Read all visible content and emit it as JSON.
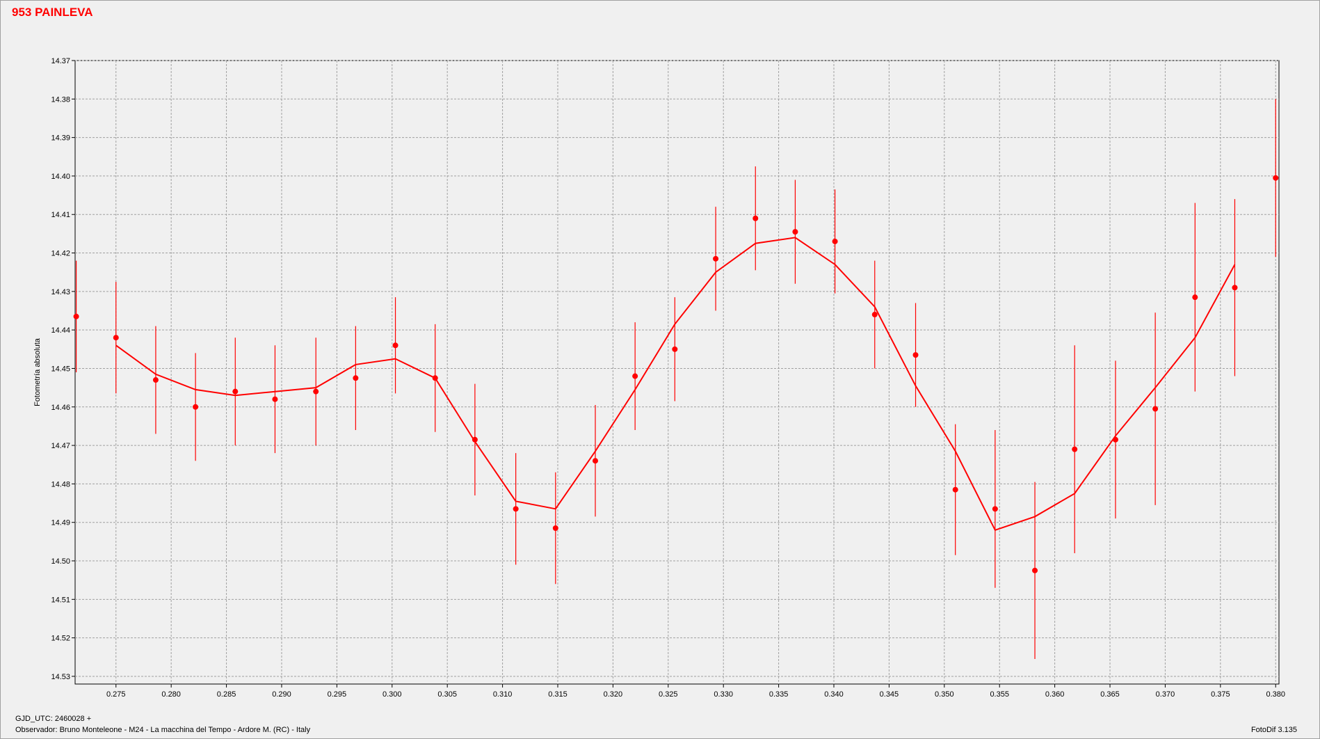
{
  "title": "953 PAINLEVA",
  "footer": {
    "gjd": "GJD_UTC: 2460028 +",
    "observer": "Observador: Bruno Monteleone - M24 - La macchina del Tempo - Ardore M. (RC) - Italy",
    "software": "FotoDif 3.135"
  },
  "colors": {
    "series": "#ff0000",
    "grid": "#a0a0a0",
    "background": "#f0f0f0"
  },
  "chart_data": {
    "type": "scatter",
    "title": "953 PAINLEVA",
    "xlabel": "",
    "ylabel": "Fotometría absoluta",
    "xlim": [
      0.2713,
      0.3803
    ],
    "ylim": [
      14.37,
      14.532
    ],
    "y_inverted": true,
    "grid": true,
    "x_ticks": [
      "0.275",
      "0.280",
      "0.285",
      "0.290",
      "0.295",
      "0.300",
      "0.305",
      "0.310",
      "0.315",
      "0.320",
      "0.325",
      "0.330",
      "0.335",
      "0.340",
      "0.345",
      "0.350",
      "0.355",
      "0.360",
      "0.365",
      "0.370",
      "0.375",
      "0.380"
    ],
    "y_ticks": [
      "14.37",
      "14.38",
      "14.39",
      "14.40",
      "14.41",
      "14.42",
      "14.43",
      "14.44",
      "14.45",
      "14.46",
      "14.47",
      "14.48",
      "14.49",
      "14.50",
      "14.51",
      "14.52",
      "14.53"
    ],
    "series": [
      {
        "kind": "points_with_errorbars",
        "x": [
          0.2714,
          0.275,
          0.2786,
          0.2822,
          0.2858,
          0.2894,
          0.2931,
          0.2967,
          0.3003,
          0.3039,
          0.3075,
          0.3112,
          0.3148,
          0.3184,
          0.322,
          0.3256,
          0.3293,
          0.3329,
          0.3365,
          0.3401,
          0.3437,
          0.3474,
          0.351,
          0.3546,
          0.3582,
          0.3618,
          0.3655,
          0.3691,
          0.3727,
          0.3763,
          0.38
        ],
        "y": [
          14.4365,
          14.442,
          14.453,
          14.46,
          14.456,
          14.458,
          14.456,
          14.4525,
          14.444,
          14.4525,
          14.4685,
          14.4865,
          14.4915,
          14.474,
          14.452,
          14.445,
          14.4215,
          14.411,
          14.4145,
          14.417,
          14.436,
          14.4465,
          14.4815,
          14.4865,
          14.5025,
          14.471,
          14.4685,
          14.4605,
          14.4315,
          14.429,
          14.4005
        ],
        "err": [
          0.0145,
          0.0145,
          0.014,
          0.014,
          0.014,
          0.014,
          0.014,
          0.0135,
          0.0125,
          0.014,
          0.0145,
          0.0145,
          0.0145,
          0.0145,
          0.014,
          0.0135,
          0.0135,
          0.0135,
          0.0135,
          0.0135,
          0.014,
          0.0135,
          0.017,
          0.0205,
          0.023,
          0.027,
          0.0205,
          0.025,
          0.0245,
          0.023,
          0.0205
        ]
      },
      {
        "kind": "line",
        "x": [
          0.275,
          0.2786,
          0.2822,
          0.2858,
          0.2894,
          0.2931,
          0.2967,
          0.3003,
          0.3039,
          0.3075,
          0.3112,
          0.3148,
          0.3184,
          0.322,
          0.3256,
          0.3293,
          0.3329,
          0.3365,
          0.3401,
          0.3437,
          0.3474,
          0.351,
          0.3546,
          0.3582,
          0.3618,
          0.3655,
          0.3691,
          0.3727,
          0.3763
        ],
        "y": [
          14.444,
          14.4515,
          14.4555,
          14.457,
          14.456,
          14.455,
          14.449,
          14.4475,
          14.4525,
          14.469,
          14.4845,
          14.4865,
          14.4715,
          14.4555,
          14.4385,
          14.425,
          14.4175,
          14.416,
          14.423,
          14.434,
          14.4545,
          14.4715,
          14.492,
          14.4885,
          14.4825,
          14.4675,
          14.455,
          14.442,
          14.423
        ]
      }
    ]
  }
}
